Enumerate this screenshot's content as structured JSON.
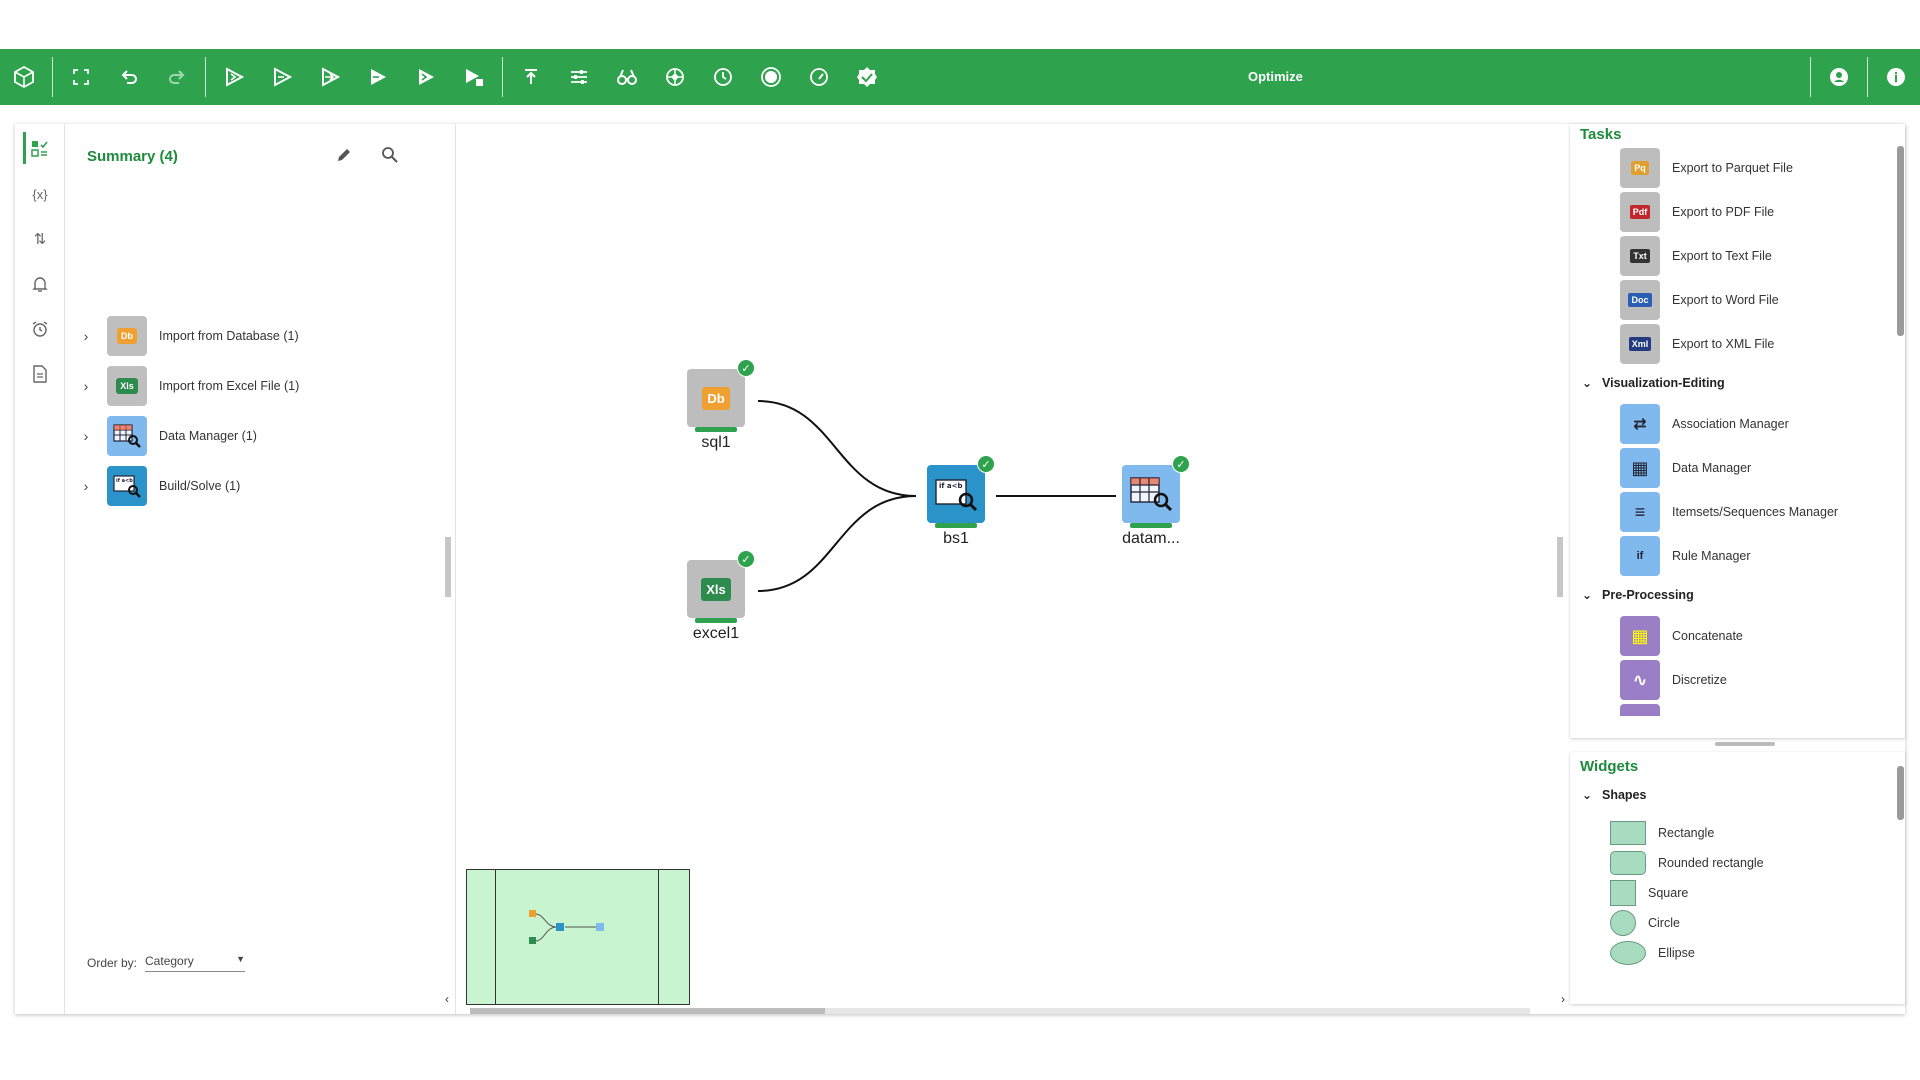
{
  "toolbar": {
    "title": "Optimize",
    "buttons": [
      "home-icon",
      "fit-screen-icon",
      "undo-icon",
      "redo-icon",
      "run-icon",
      "run-step-icon",
      "run-from-icon",
      "run-to-icon",
      "run-all-icon",
      "run-selected-icon",
      "upload-icon",
      "settings-sliders-icon",
      "binoculars-icon",
      "network-icon",
      "clock-icon",
      "record-icon",
      "speed-icon",
      "verified-icon"
    ],
    "right": [
      "account-icon",
      "info-icon"
    ],
    "accent": "#2ea24d"
  },
  "summary": {
    "title": "Summary (4)",
    "items": [
      {
        "label": "Import from Database (1)",
        "icon": "database-import-icon",
        "color": "#f0a030",
        "badge": "Db"
      },
      {
        "label": "Import from Excel File (1)",
        "icon": "excel-import-icon",
        "color": "#2e8b4e",
        "badge": "Xls"
      },
      {
        "label": "Data Manager (1)",
        "icon": "data-manager-icon",
        "color": "#6aaee8",
        "badge": "▦"
      },
      {
        "label": "Build/Solve (1)",
        "icon": "build-solve-icon",
        "color": "#2a93c9",
        "badge": "if"
      }
    ],
    "order_by_label": "Order by:",
    "order_by_value": "Category"
  },
  "canvas": {
    "nodes": [
      {
        "id": "sql1",
        "label": "sql1",
        "badge": "Db",
        "color": "#f0a030"
      },
      {
        "id": "excel1",
        "label": "excel1",
        "badge": "Xls",
        "color": "#2e8b4e"
      },
      {
        "id": "bs1",
        "label": "bs1",
        "badge": "if",
        "color": "#2a93c9"
      },
      {
        "id": "datam",
        "label": "datam...",
        "badge": "▦",
        "color": "#6aaee8"
      }
    ]
  },
  "tasks": {
    "title": "Tasks",
    "export_items": [
      {
        "label": "Export to Parquet File",
        "badge": "Pq"
      },
      {
        "label": "Export to PDF File",
        "badge": "Pdf"
      },
      {
        "label": "Export to Text File",
        "badge": "Txt"
      },
      {
        "label": "Export to Word File",
        "badge": "Doc"
      },
      {
        "label": "Export to XML File",
        "badge": "Xml"
      }
    ],
    "groups": [
      {
        "label": "Visualization-Editing",
        "items": [
          {
            "label": "Association Manager",
            "badge": "⇄"
          },
          {
            "label": "Data Manager",
            "badge": "▦"
          },
          {
            "label": "Itemsets/Sequences Manager",
            "badge": "≡"
          },
          {
            "label": "Rule Manager",
            "badge": "if"
          }
        ]
      },
      {
        "label": "Pre-Processing",
        "items": [
          {
            "label": "Concatenate",
            "badge": "▦"
          },
          {
            "label": "Discretize",
            "badge": "∿"
          }
        ]
      }
    ]
  },
  "widgets": {
    "title": "Widgets",
    "group": "Shapes",
    "shapes": [
      "Rectangle",
      "Rounded rectangle",
      "Square",
      "Circle",
      "Ellipse"
    ]
  }
}
